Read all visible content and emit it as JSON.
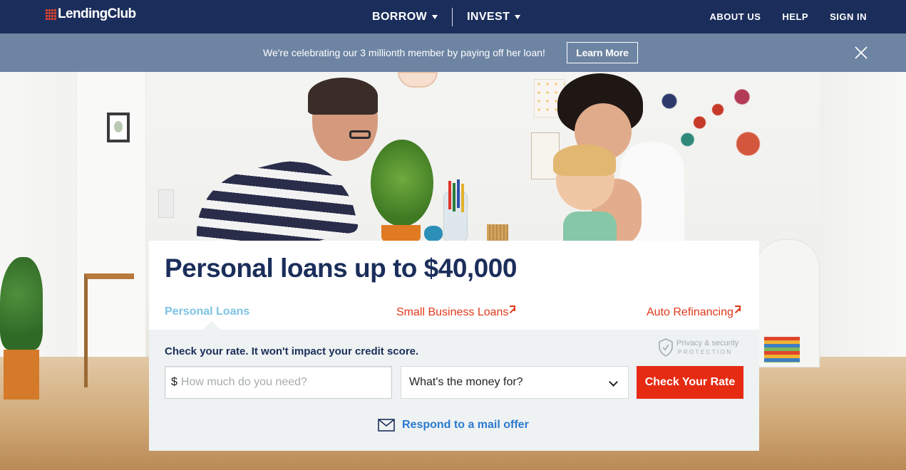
{
  "nav": {
    "logo_text": "LendingClub",
    "borrow_label": "BORROW",
    "invest_label": "INVEST",
    "about_label": "ABOUT US",
    "help_label": "HELP",
    "signin_label": "SIGN IN"
  },
  "banner": {
    "message": "We're celebrating our 3 millionth member by paying off her loan!",
    "learn_more_label": "Learn More",
    "close_icon": "close-icon"
  },
  "card": {
    "title": "Personal loans up to $40,000",
    "tabs": [
      {
        "label": "Personal Loans",
        "active": true
      },
      {
        "label": "Small Business Loans",
        "external": true
      },
      {
        "label": "Auto Refinancing",
        "external": true
      }
    ],
    "check_label": "Check your rate. It won't impact your credit score.",
    "privacy": {
      "line1": "Privacy & security",
      "line2": "PROTECTION",
      "icon": "shield-check-icon"
    },
    "amount": {
      "currency_symbol": "$",
      "placeholder": "How much do you need?",
      "value": ""
    },
    "purpose": {
      "selected": "What's the money for?"
    },
    "check_rate_label": "Check Your Rate",
    "mail_offer_label": "Respond to a mail offer",
    "mail_icon": "envelope-icon"
  },
  "colors": {
    "nav_bg": "#1b2e5b",
    "banner_bg": "#6d84a3",
    "accent_red": "#e62b13",
    "tab_active": "#7cc3e4",
    "link_blue": "#2b7ad0",
    "panel_bg": "#eef2f2"
  }
}
